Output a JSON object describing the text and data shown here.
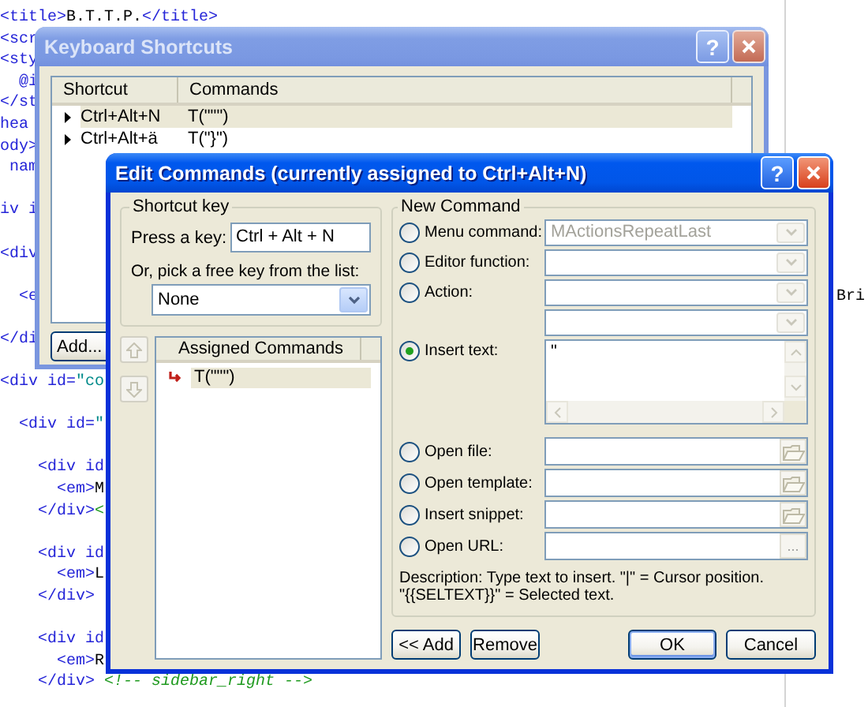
{
  "editor": {
    "lines": [
      {
        "kind": "code",
        "segments": [
          {
            "text": "<title>",
            "kind": "tag"
          },
          {
            "text": "B.T.T.P.",
            "kind": "text"
          },
          {
            "text": "</title>",
            "kind": "tag"
          }
        ]
      },
      {
        "kind": "code",
        "segments": [
          {
            "text": "<scr",
            "kind": "tag"
          }
        ]
      },
      {
        "kind": "code",
        "segments": [
          {
            "text": "<sty",
            "kind": "tag"
          }
        ]
      },
      {
        "kind": "code",
        "segments": [
          {
            "text": "  @i",
            "kind": "tag"
          }
        ]
      },
      {
        "kind": "code",
        "segments": [
          {
            "text": "</st",
            "kind": "tag"
          }
        ]
      },
      {
        "kind": "code",
        "segments": [
          {
            "text": "hea",
            "kind": "tag"
          }
        ]
      },
      {
        "kind": "code",
        "segments": [
          {
            "text": "ody>",
            "kind": "tag"
          }
        ]
      },
      {
        "kind": "code",
        "segments": [
          {
            "text": " nam",
            "kind": "tag"
          }
        ]
      },
      {
        "kind": "blank"
      },
      {
        "kind": "code",
        "segments": [
          {
            "text": "iv i",
            "kind": "tag"
          }
        ]
      },
      {
        "kind": "blank"
      },
      {
        "kind": "code",
        "segments": [
          {
            "text": "<div",
            "kind": "tag"
          }
        ]
      },
      {
        "kind": "blank"
      },
      {
        "kind": "code",
        "segments": [
          {
            "text": "  <e",
            "kind": "tag"
          }
        ],
        "aside": "Bri"
      },
      {
        "kind": "blank"
      },
      {
        "kind": "code",
        "segments": [
          {
            "text": "</di",
            "kind": "tag"
          }
        ]
      },
      {
        "kind": "blank"
      },
      {
        "kind": "code",
        "segments": [
          {
            "text": "<div id=",
            "kind": "tag"
          },
          {
            "text": "\"co",
            "kind": "value"
          }
        ]
      },
      {
        "kind": "blank"
      },
      {
        "kind": "code",
        "segments": [
          {
            "text": "  <div id=",
            "kind": "tag"
          },
          {
            "text": "\"",
            "kind": "value"
          }
        ]
      },
      {
        "kind": "blank"
      },
      {
        "kind": "code",
        "segments": [
          {
            "text": "    <div id",
            "kind": "tag"
          }
        ]
      },
      {
        "kind": "code",
        "segments": [
          {
            "text": "      <em>",
            "kind": "tag"
          },
          {
            "text": "M",
            "kind": "text"
          }
        ]
      },
      {
        "kind": "code",
        "segments": [
          {
            "text": "    </div>",
            "kind": "tag"
          },
          {
            "text": "<",
            "kind": "comment"
          }
        ]
      },
      {
        "kind": "blank"
      },
      {
        "kind": "code",
        "segments": [
          {
            "text": "    <div id",
            "kind": "tag"
          }
        ]
      },
      {
        "kind": "code",
        "segments": [
          {
            "text": "      <em>",
            "kind": "tag"
          },
          {
            "text": "L",
            "kind": "text"
          }
        ]
      },
      {
        "kind": "code",
        "segments": [
          {
            "text": "    </div>",
            "kind": "tag"
          }
        ]
      },
      {
        "kind": "blank"
      },
      {
        "kind": "code",
        "segments": [
          {
            "text": "    <div id",
            "kind": "tag"
          }
        ]
      },
      {
        "kind": "code",
        "segments": [
          {
            "text": "      <em>",
            "kind": "tag"
          },
          {
            "text": "R",
            "kind": "text"
          }
        ]
      },
      {
        "kind": "code",
        "segments": [
          {
            "text": "    </div> ",
            "kind": "tag"
          },
          {
            "text": "<!-- sidebar_right -->",
            "kind": "comment"
          }
        ]
      }
    ]
  },
  "shortcuts_window": {
    "title": "Keyboard Shortcuts",
    "active": false,
    "help_glyph": "?",
    "columns": [
      "Shortcut",
      "Commands"
    ],
    "rows": [
      {
        "shortcut": "Ctrl+Alt+N",
        "command": "T(\"\"\")",
        "selected": true
      },
      {
        "shortcut": "Ctrl+Alt+ä",
        "command": "T(\"}\")",
        "selected": false
      }
    ],
    "button": "Add..."
  },
  "edit_window": {
    "title": "Edit Commands (currently assigned to Ctrl+Alt+N)",
    "active": true,
    "help_glyph": "?",
    "shortcut_group": {
      "label": "Shortcut key",
      "press_label": "Press a key:",
      "press_value": "Ctrl + Alt + N",
      "pick_label": "Or, pick a free key from the list:",
      "pick_value": "None"
    },
    "move_buttons": [
      {
        "kind": "up"
      },
      {
        "kind": "down"
      }
    ],
    "assigned": {
      "header": "Assigned Commands",
      "items": [
        {
          "text": "T(\"\"\")",
          "selected": true
        }
      ]
    },
    "new_command": {
      "label": "New Command",
      "options": [
        {
          "kind": "dropdown",
          "label": "Menu command:",
          "selected": false,
          "value": "MActionsRepeatLast"
        },
        {
          "kind": "dropdown",
          "label": "Editor function:",
          "selected": false
        },
        {
          "kind": "dropdown",
          "label": "Action:",
          "selected": false
        },
        {
          "kind": "subdropdown"
        },
        {
          "kind": "textarea",
          "label": "Insert text:",
          "selected": true,
          "value": "\""
        },
        {
          "kind": "file",
          "label": "Open file:",
          "selected": false
        },
        {
          "kind": "file",
          "label": "Open template:",
          "selected": false
        },
        {
          "kind": "file",
          "label": "Insert snippet:",
          "selected": false
        },
        {
          "kind": "url",
          "label": "Open URL:",
          "selected": false,
          "browse_glyph": "..."
        }
      ],
      "description": [
        "Description: Type text to insert. \"|\" = Cursor position.",
        "\"{{SELTEXT}}\" = Selected text."
      ]
    },
    "buttons": [
      {
        "label": "<< Add",
        "default": false
      },
      {
        "label": "Remove",
        "default": false
      },
      {
        "label": "OK",
        "default": true
      },
      {
        "label": "Cancel",
        "default": false
      }
    ]
  }
}
